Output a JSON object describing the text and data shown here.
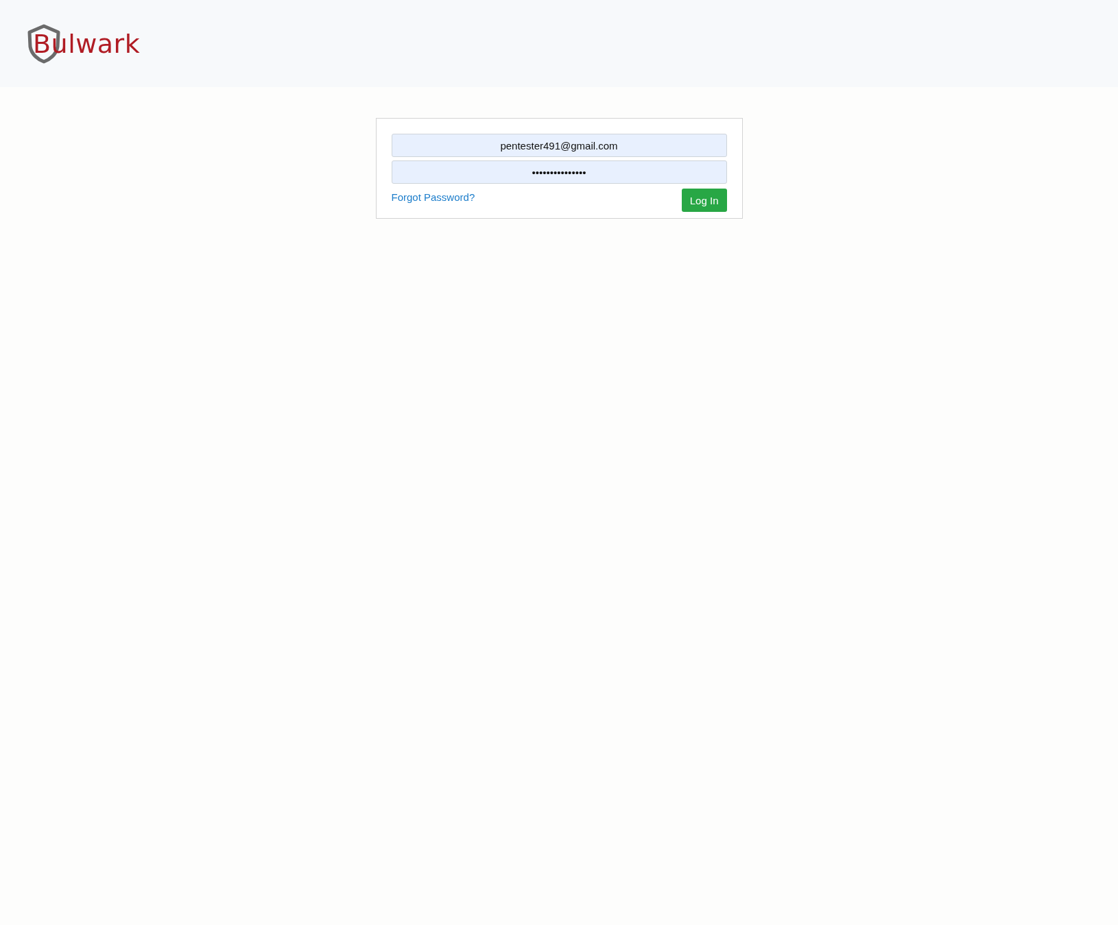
{
  "header": {
    "logo": "Bulwark"
  },
  "login": {
    "email": {
      "value": "pentester491@gmail.com"
    },
    "password": {
      "value": "•••••••••••••••"
    },
    "forgot_link": "Forgot Password?",
    "submit": "Log In"
  }
}
